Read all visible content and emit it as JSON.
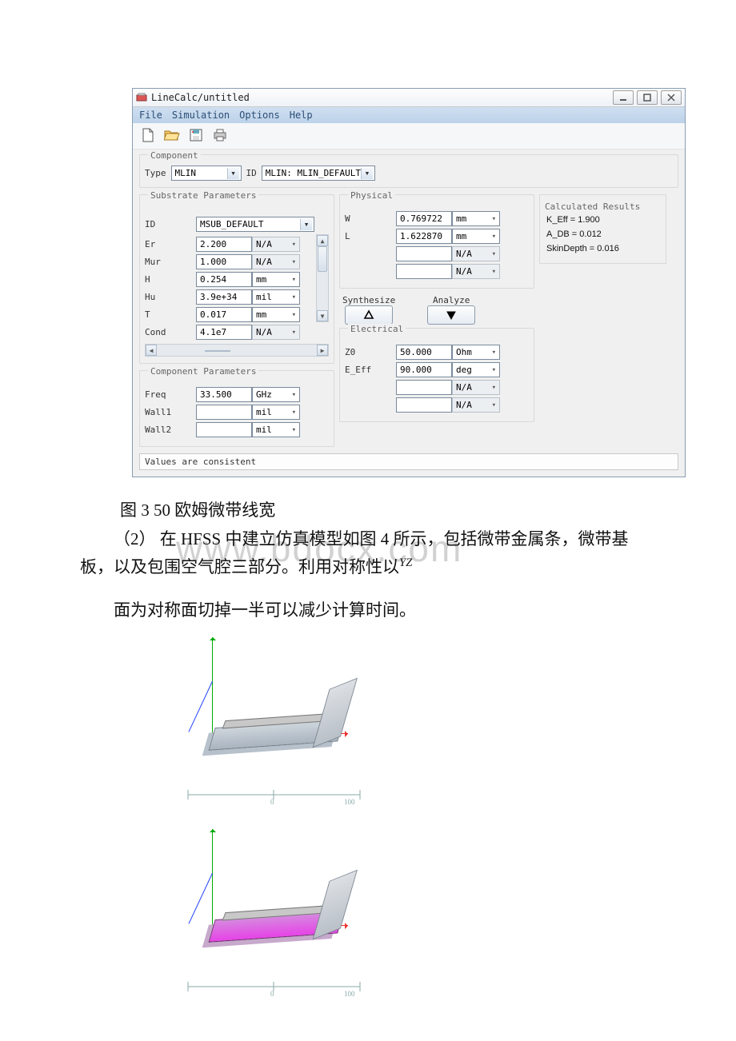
{
  "window": {
    "title": "LineCalc/untitled",
    "menus": [
      "File",
      "Simulation",
      "Options",
      "Help"
    ],
    "status": "Values are consistent"
  },
  "component": {
    "group_label": "Component",
    "type_label": "Type",
    "type_value": "MLIN",
    "id_label": "ID",
    "id_value": "MLIN: MLIN_DEFAULT"
  },
  "substrate": {
    "group_label": "Substrate Parameters",
    "id_label": "ID",
    "id_value": "MSUB_DEFAULT",
    "rows": [
      {
        "name": "Er",
        "value": "2.200",
        "unit": "N/A"
      },
      {
        "name": "Mur",
        "value": "1.000",
        "unit": "N/A"
      },
      {
        "name": "H",
        "value": "0.254",
        "unit": "mm"
      },
      {
        "name": "Hu",
        "value": "3.9e+34",
        "unit": "mil"
      },
      {
        "name": "T",
        "value": "0.017",
        "unit": "mm"
      },
      {
        "name": "Cond",
        "value": "4.1e7",
        "unit": "N/A"
      }
    ]
  },
  "component_params": {
    "group_label": "Component Parameters",
    "rows": [
      {
        "name": "Freq",
        "value": "33.500",
        "unit": "GHz"
      },
      {
        "name": "Wall1",
        "value": "",
        "unit": "mil"
      },
      {
        "name": "Wall2",
        "value": "",
        "unit": "mil"
      }
    ]
  },
  "physical": {
    "group_label": "Physical",
    "rows": [
      {
        "name": "W",
        "value": "0.769722",
        "unit": "mm"
      },
      {
        "name": "L",
        "value": "1.622870",
        "unit": "mm"
      },
      {
        "name": "",
        "value": "",
        "unit": "N/A"
      },
      {
        "name": "",
        "value": "",
        "unit": "N/A"
      }
    ]
  },
  "actions": {
    "synthesize_label": "Synthesize",
    "analyze_label": "Analyze"
  },
  "electrical": {
    "group_label": "Electrical",
    "rows": [
      {
        "name": "Z0",
        "value": "50.000",
        "unit": "Ohm"
      },
      {
        "name": "E_Eff",
        "value": "90.000",
        "unit": "deg"
      },
      {
        "name": "",
        "value": "",
        "unit": "N/A"
      },
      {
        "name": "",
        "value": "",
        "unit": "N/A"
      }
    ]
  },
  "results": {
    "group_label": "Calculated Results",
    "lines": [
      "K_Eff = 1.900",
      "A_DB = 0.012",
      "SkinDepth = 0.016"
    ]
  },
  "doc": {
    "caption": "图 3 50 欧姆微带线宽",
    "para1": "（2） 在 HFSS 中建立仿真模型如图 4 所示，包括微带金属条，微带基板，以及包围空气腔三部分。利用对称性以",
    "para1_sup": "YZ",
    "para2": "面为对称面切掉一半可以减少计算时间。",
    "watermark": "www.bdocx.com"
  }
}
